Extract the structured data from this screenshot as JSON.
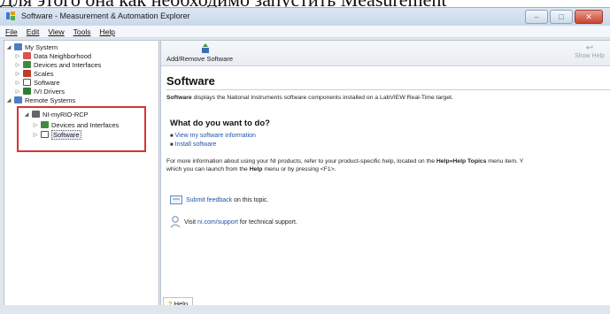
{
  "top_text": "Для этого она как необходимо запустить Measurement",
  "window": {
    "title": "Software - Measurement & Automation Explorer",
    "controls": {
      "minimize": "–",
      "maximize": "□",
      "close": "✕"
    }
  },
  "menu": [
    "File",
    "Edit",
    "View",
    "Tools",
    "Help"
  ],
  "tree": {
    "my_system": "My System",
    "data_neighborhood": "Data Neighborhood",
    "devices_interfaces": "Devices and Interfaces",
    "scales": "Scales",
    "software": "Software",
    "ivi_drivers": "IVI Drivers",
    "remote_systems": "Remote Systems",
    "target": "NI-myRIO-RCP",
    "target_devices": "Devices and Interfaces",
    "target_software": "Software"
  },
  "toolbar": {
    "add_remove": "Add/Remove Software",
    "show_help": "Show Help"
  },
  "content": {
    "title": "Software",
    "desc_bold": "Software",
    "desc_rest": " displays the National Instruments software components installed on a LabVIEW Real-Time target.",
    "question": "What do you want to do?",
    "link1": "View my software information",
    "link2": "Install software",
    "more_info_1_pre": "For more information about using your NI products, refer to your product-specific help, located on the ",
    "more_info_1_bold": "Help»Help Topics",
    "more_info_1_post": " menu item. Y",
    "more_info_2_pre": "which you can launch from the ",
    "more_info_2_bold": "Help",
    "more_info_2_post": " menu or by pressing <F1>.",
    "feedback_link": "Submit feedback",
    "feedback_rest": " on this topic.",
    "support_pre": "Visit ",
    "support_link": "ni.com/support",
    "support_post": " for technical support."
  },
  "help_tab": "Help"
}
